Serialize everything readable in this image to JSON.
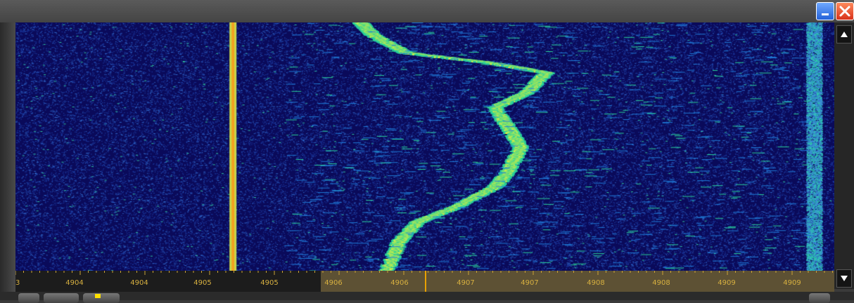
{
  "window": {
    "controls": {
      "minimize_icon": "minimize-icon",
      "close_icon": "close-icon"
    }
  },
  "waterfall": {
    "colors": {
      "background": "#0a0a5a",
      "signal_low": "#1e7bd8",
      "signal_mid": "#29d19a",
      "signal_high": "#e8f23a",
      "carrier": "#f3a020"
    },
    "carrier_frequency": 4905.0,
    "freq_min": 4903.3,
    "freq_max": 4909.7
  },
  "scale": {
    "labels": [
      "3",
      "4904",
      "4904",
      "4905",
      "4905",
      "4906",
      "4906",
      "4907",
      "4907",
      "4908",
      "4908",
      "4909",
      "4909"
    ],
    "selection_fraction_start": 0.373,
    "selection_fraction_end": 1.0,
    "cursor_fraction": 0.5
  },
  "scrollbar": {
    "up_icon": "arrow-up-icon",
    "down_icon": "arrow-down-icon"
  }
}
